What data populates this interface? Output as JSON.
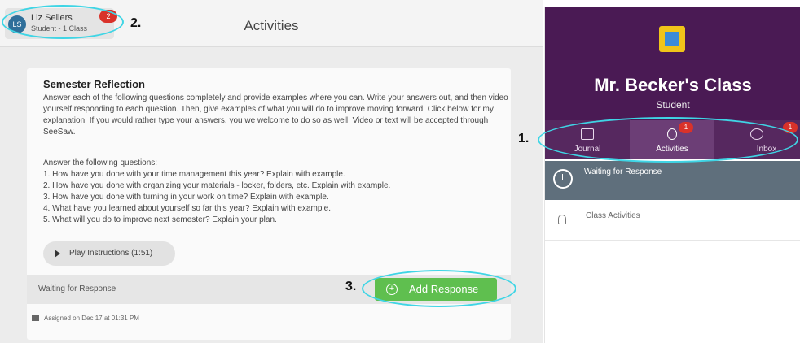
{
  "user": {
    "initials": "LS",
    "name": "Liz Sellers",
    "role": "Student - 1 Class",
    "badge_count": "2"
  },
  "page": {
    "title": "Activities"
  },
  "activity": {
    "title": "Semester Reflection",
    "description": "Answer each of the following questions completely and provide examples where you can. Write your answers out, and then video yourself responding to each question. Then, give examples of what you will do to improve moving forward. Click below for my explanation. If you would rather type your answers, you we welcome to do so as well. Video or text will be accepted through SeeSaw.",
    "questions_intro": "Answer the following questions:",
    "questions": [
      "1. How have you done with your time management this year? Explain with example.",
      "2. How have you done with organizing your materials - locker, folders, etc. Explain with example.",
      "3. How have you done with turning in your work on time? Explain with example.",
      "4. What have you learned about yourself so far this year? Explain with example.",
      "5. What will you do to improve next semester? Explain your plan."
    ],
    "play_label": "Play Instructions (1:51)",
    "status": "Waiting for Response",
    "add_response_label": "Add Response",
    "assigned": "Assigned on Dec 17 at 01:31 PM"
  },
  "class_panel": {
    "name": "Mr. Becker's Class",
    "role": "Student",
    "accent_color": "#4a1a54",
    "nav": [
      {
        "label": "Journal",
        "icon": "book-icon",
        "badge": ""
      },
      {
        "label": "Activities",
        "icon": "lightbulb-icon",
        "badge": "1"
      },
      {
        "label": "Inbox",
        "icon": "chat-icon",
        "badge": "1"
      }
    ],
    "waiting_label": "Waiting for Response",
    "class_activities_label": "Class Activities"
  },
  "annotations": {
    "one": "1.",
    "two": "2.",
    "three": "3."
  }
}
